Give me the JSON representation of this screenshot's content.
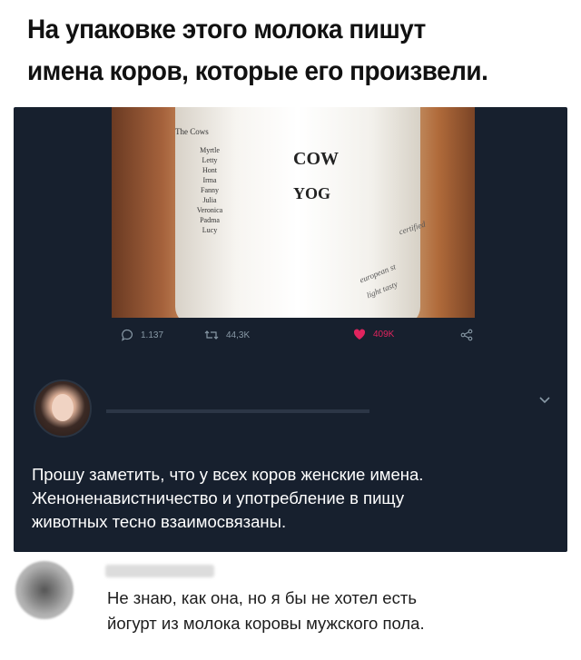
{
  "headline": {
    "line1": "На упаковке этого молока пишут",
    "line2": "имена коров, которые его произвели."
  },
  "tweet": {
    "photo": {
      "column_title": "The Cows",
      "names": [
        "Myrtle",
        "Letty",
        "Hont",
        "Irma",
        "Fanny",
        "Julia",
        "Veronica",
        "Padma",
        "Lucy"
      ],
      "brand_line1": "COW",
      "brand_line2": "YOG",
      "side_text1": "certified",
      "side_text2": "european st",
      "side_text3": "light tasty"
    },
    "actions": {
      "replies": "1.137",
      "retweets": "44,3K",
      "likes": "409K"
    },
    "text": {
      "line1": "Прошу заметить, что у всех коров женские имена.",
      "line2": "Женоненавистничество и употребление в пищу",
      "line3": "животных тесно взаимосвязаны."
    }
  },
  "reply": {
    "line1": "Не знаю, как она, но я бы не хотел есть",
    "line2": "йогурт из молока коровы мужского пола."
  },
  "colors": {
    "card_bg": "#17202e",
    "icon_gray": "#8899a6",
    "like_red": "#e0245e"
  },
  "icons": [
    "reply-icon",
    "retweet-icon",
    "heart-icon",
    "share-icon",
    "chevron-down-icon"
  ]
}
